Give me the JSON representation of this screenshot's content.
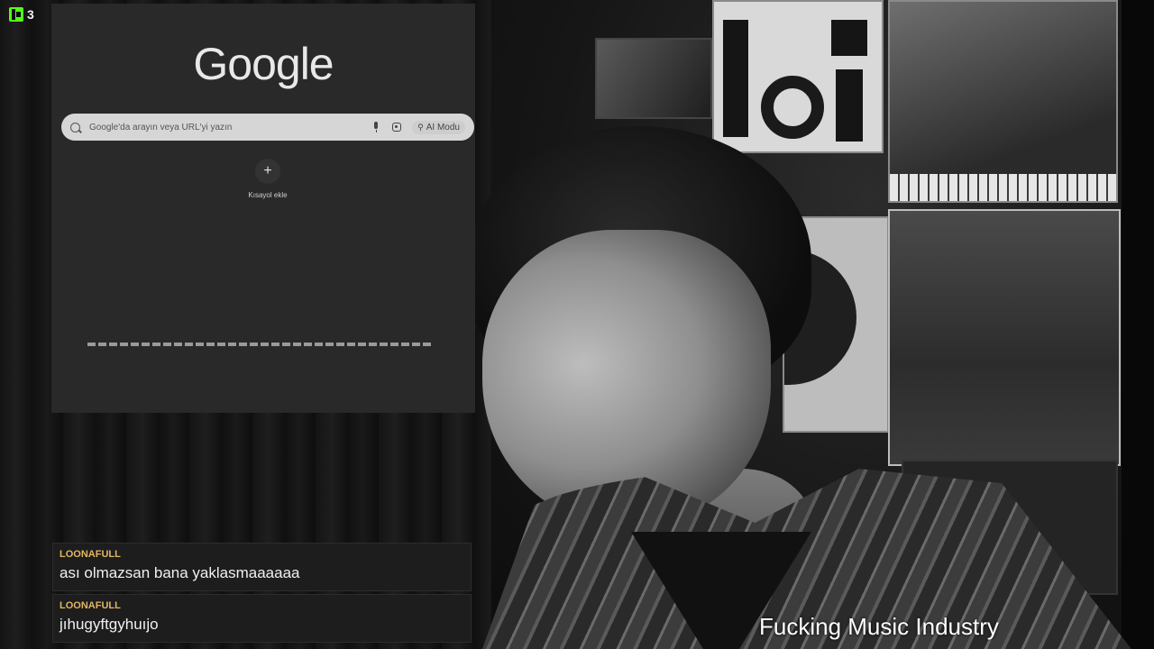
{
  "stream": {
    "logo_icon": "kick-logo-icon",
    "viewer_count": "3",
    "accent_color": "#53fc18"
  },
  "browser": {
    "google_logo": "Google",
    "search": {
      "placeholder": "Google'da arayın veya URL'yi yazın",
      "mic_icon": "mic-icon",
      "lens_icon": "lens-icon",
      "ai_mode_label": "AI Modu"
    },
    "shortcut": {
      "add_symbol": "+",
      "add_label": "Kısayol ekle"
    }
  },
  "chat": {
    "messages": [
      {
        "user": "LOONAFULL",
        "text": "ası olmazsan bana yaklasmaaaaaa"
      },
      {
        "user": "LOONAFULL",
        "text": "jıhugyftgyhuıjo"
      }
    ],
    "username_color": "#e2b662"
  },
  "overlay": {
    "caption": "Fucking Music Industry"
  }
}
